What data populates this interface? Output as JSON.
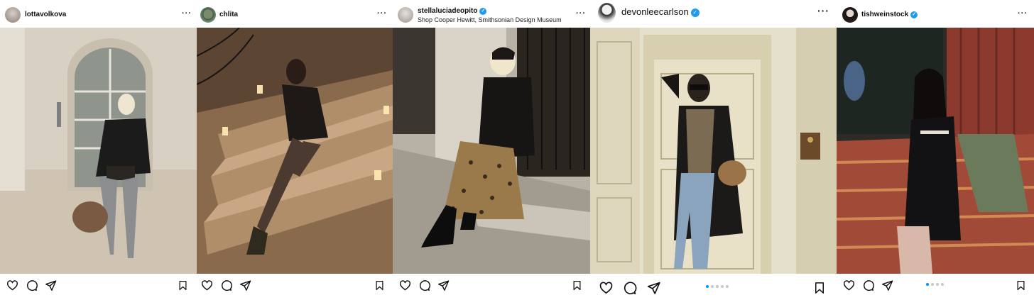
{
  "posts": [
    {
      "username": "lottavolkova",
      "verified": false,
      "location": "",
      "more": "···"
    },
    {
      "username": "chlita",
      "verified": false,
      "location": "",
      "more": "···"
    },
    {
      "username": "stellaluciadeopito",
      "verified": true,
      "location": "Shop Cooper Hewitt, Smithsonian Design Museum",
      "more": "···"
    },
    {
      "username": "devonleecarlson",
      "verified": true,
      "location": "",
      "more": "···",
      "carousel": {
        "count": 5,
        "active": 1
      }
    },
    {
      "username": "tishweinstock",
      "verified": true,
      "location": "",
      "more": "···",
      "carousel": {
        "count": 4,
        "active": 1
      }
    }
  ],
  "colors": {
    "verified_blue": "#1d9bf0",
    "carousel_active": "#0095f6"
  },
  "icons": {
    "like": "heart-icon",
    "comment": "comment-icon",
    "share": "share-icon",
    "save": "bookmark-icon",
    "verified": "verified-badge-icon"
  }
}
